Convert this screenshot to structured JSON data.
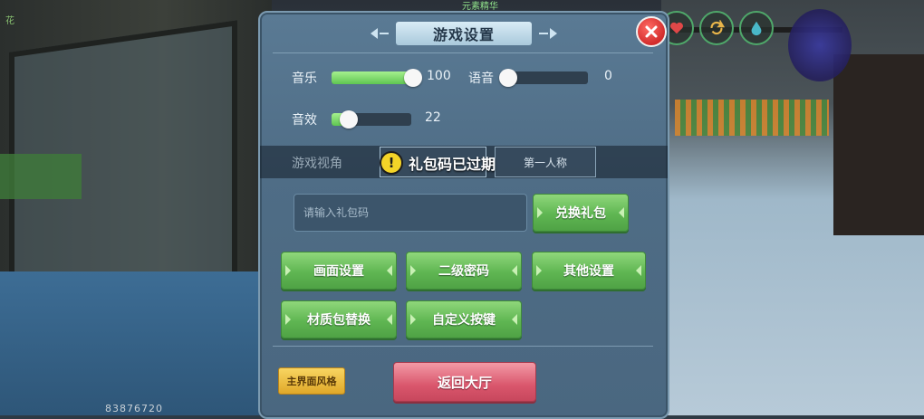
{
  "background": {
    "top_text": "元素精华",
    "corner_text": "花",
    "player_id": "83876720"
  },
  "hud": {
    "icons": [
      "heart-icon",
      "refresh-icon",
      "water-drop-icon"
    ]
  },
  "dialog": {
    "title": "游戏设置",
    "close_icon": "close-icon",
    "music": {
      "label": "音乐",
      "value": "100",
      "level": 1.0
    },
    "voice": {
      "label": "语音",
      "value": "0",
      "level": 0.0
    },
    "sfx": {
      "label": "音效",
      "value": "22",
      "level": 0.22
    },
    "view": {
      "label": "游戏视角",
      "option_first_person": "第一人称"
    },
    "toast": {
      "text": "礼包码已过期",
      "icon": "warning-icon"
    },
    "gift_code": {
      "placeholder": "请输入礼包码",
      "redeem_label": "兑换礼包"
    },
    "buttons": {
      "graphics": "画面设置",
      "second_password": "二级密码",
      "other": "其他设置",
      "texture_pack": "材质包替换",
      "custom_keys": "自定义按键"
    },
    "main_style_label": "主界面风格",
    "back_label": "返回大厅"
  },
  "colors": {
    "accent_green": "#5fb652",
    "close_red": "#d22c2c",
    "back_pink": "#d9566c",
    "style_gold": "#e0a829"
  }
}
